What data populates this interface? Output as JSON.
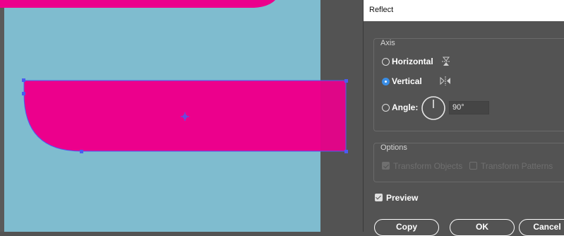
{
  "colors": {
    "canvas": "#7fbccf",
    "shape_fill": "#ec008c",
    "selection": "#4b5cf0",
    "panel": "#535353",
    "radio_checked": "#3a8ee6"
  },
  "dialog": {
    "title": "Reflect",
    "axis": {
      "group_label": "Axis",
      "options": [
        {
          "label": "Horizontal",
          "checked": false,
          "icon": "reflect-horizontal-icon"
        },
        {
          "label": "Vertical",
          "checked": true,
          "icon": "reflect-vertical-icon"
        },
        {
          "label": "Angle:",
          "checked": false,
          "icon": "angle-dial-icon"
        }
      ],
      "angle_value": "90°"
    },
    "options": {
      "group_label": "Options",
      "transform_objects_label": "Transform Objects",
      "transform_objects_checked": true,
      "transform_patterns_label": "Transform Patterns",
      "transform_patterns_checked": false
    },
    "preview_label": "Preview",
    "preview_checked": true,
    "buttons": {
      "copy": "Copy",
      "ok": "OK",
      "cancel": "Cancel"
    }
  }
}
